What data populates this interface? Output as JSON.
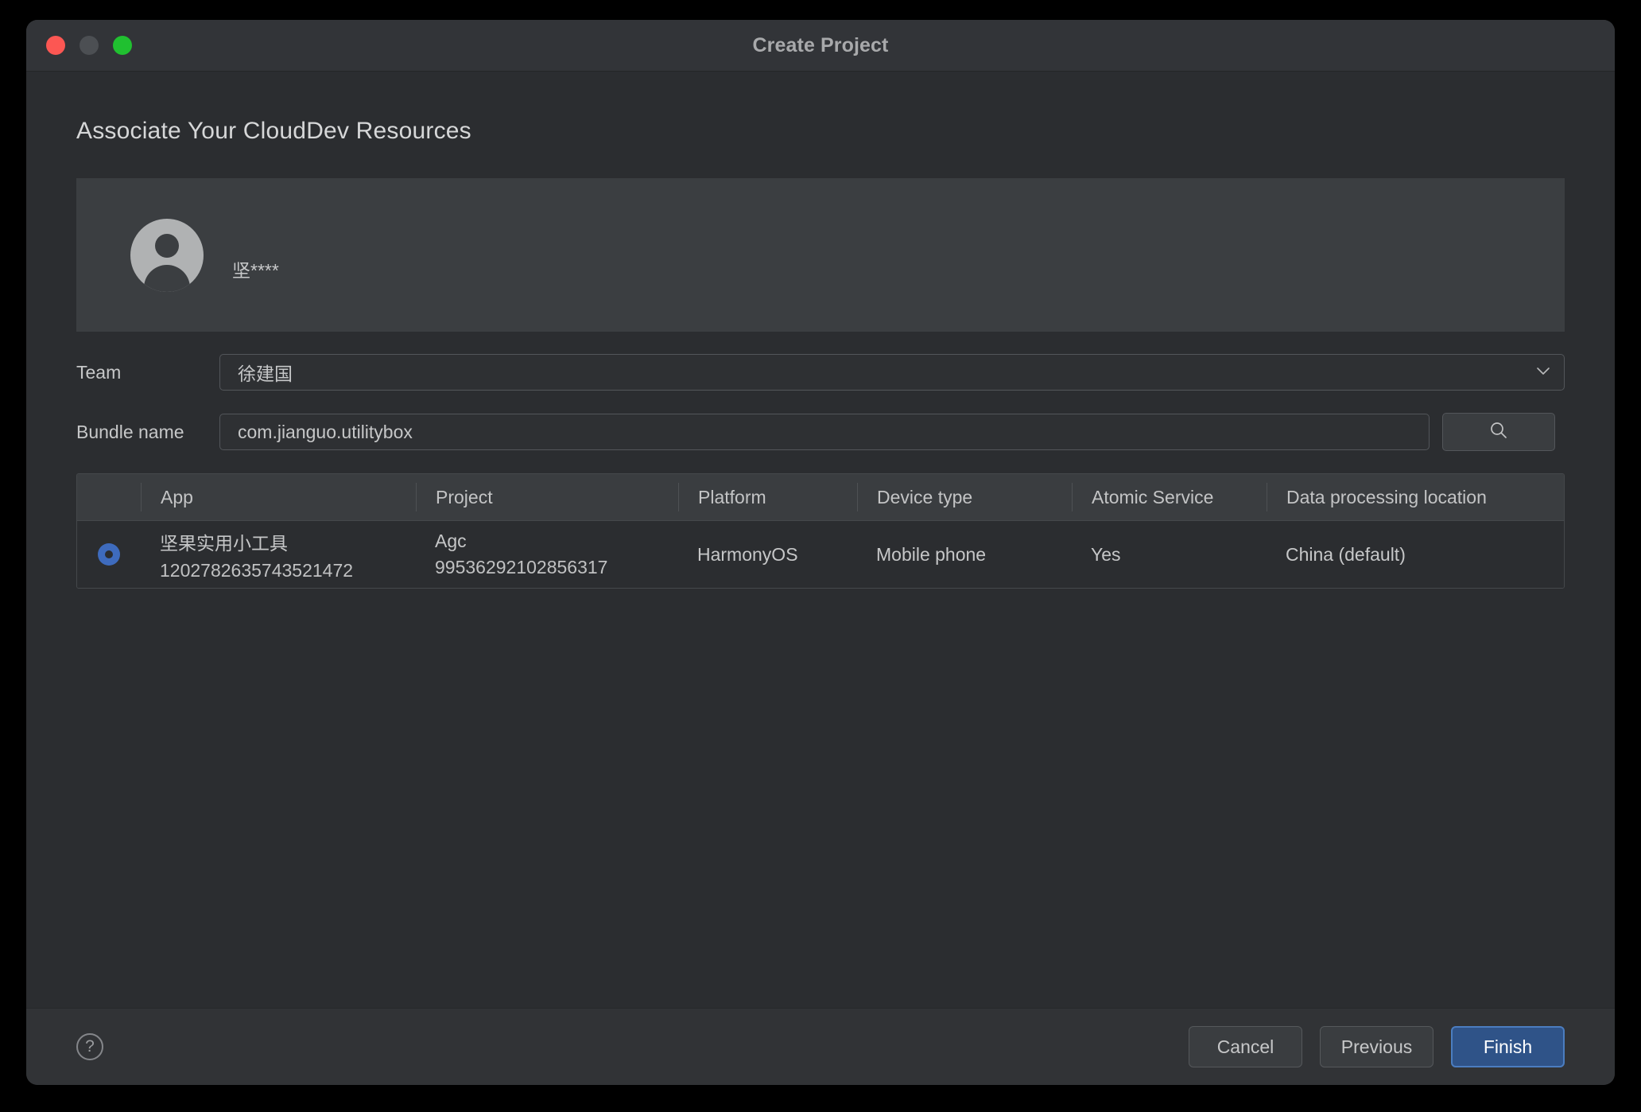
{
  "window": {
    "title": "Create Project",
    "traffic_lights": [
      "close-red",
      "minimize-yellow",
      "zoom-green"
    ]
  },
  "page": {
    "heading": "Associate Your CloudDev Resources"
  },
  "account": {
    "avatar_icon": "user-avatar-icon",
    "name": "坚****"
  },
  "form": {
    "team": {
      "label": "Team",
      "value": "徐建国",
      "chevron_icon": "chevron-down-icon"
    },
    "bundle": {
      "label": "Bundle name",
      "value": "com.jianguo.utilitybox",
      "placeholder": "com.jianguo.utilitybox",
      "search_icon": "search-icon"
    }
  },
  "table": {
    "columns": [
      "App",
      "Project",
      "Platform",
      "Device type",
      "Atomic Service",
      "Data processing location"
    ],
    "rows": [
      {
        "selected": true,
        "app_name": "坚果实用小工具",
        "app_id": "1202782635743521472",
        "project_name": "Agc",
        "project_id": "99536292102856317",
        "platform": "HarmonyOS",
        "device_type": "Mobile phone",
        "atomic_service": "Yes",
        "data_location": "China (default)"
      }
    ]
  },
  "footer": {
    "help_icon": "help-question-icon",
    "cancel_label": "Cancel",
    "previous_label": "Previous",
    "finish_label": "Finish"
  },
  "colors": {
    "window_bg": "#2b2d30",
    "titlebar_bg": "#323438",
    "panel_bg": "#3b3e41",
    "accent_blue": "#3e6bbd",
    "primary_button": "#2f5388",
    "primary_button_border": "#4b7dc0",
    "text_primary": "#c6c7c8",
    "close_red": "#fc5753",
    "minimize_gray": "#4c4f53",
    "zoom_green": "#20c030"
  }
}
